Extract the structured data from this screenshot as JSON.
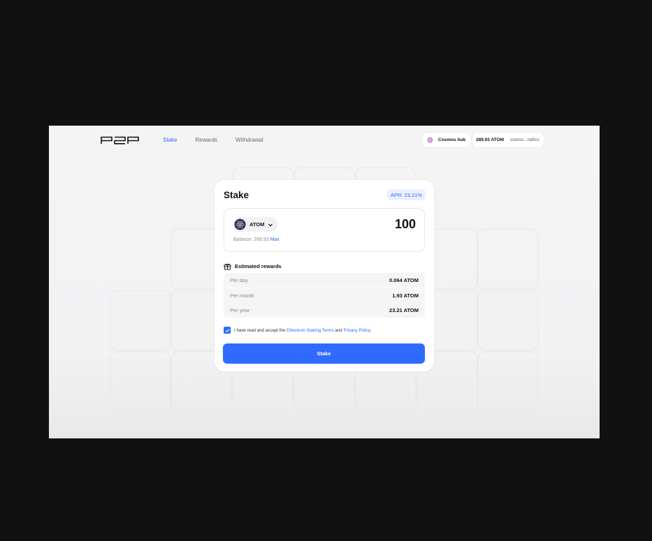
{
  "header": {
    "nav": [
      {
        "label": "Stake",
        "active": true
      },
      {
        "label": "Rewards",
        "active": false
      },
      {
        "label": "Withdrawal",
        "active": false
      }
    ],
    "network": {
      "label": "Cosmos hub",
      "icon": "cosmos-icon"
    },
    "wallet": {
      "balance": "289.93 ATOM",
      "address": "cosmo...nd0cv"
    }
  },
  "card": {
    "title": "Stake",
    "apr": "APR: 23.21%",
    "token": {
      "symbol": "ATOM",
      "icon": "atom-icon"
    },
    "amount": "100",
    "balance_label": "Balance: 289.93",
    "max_label": "Max",
    "rewards_title": "Estimated rewards",
    "rewards": [
      {
        "label": "Per day",
        "value": "0.064 ATOM"
      },
      {
        "label": "Per month",
        "value": "1.93 ATOM"
      },
      {
        "label": "Per year",
        "value": "23.21 ATOM"
      }
    ],
    "terms": {
      "prefix": "I have read and accept the",
      "link1": "Ethereum Staking Terms",
      "and": "and",
      "link2": "Privacy Policy",
      "suffix": ".",
      "checked": true
    },
    "button_label": "Stake"
  },
  "colors": {
    "accent": "#2f6bff",
    "background": "#111111",
    "app_bg": "#f4f4f5"
  }
}
